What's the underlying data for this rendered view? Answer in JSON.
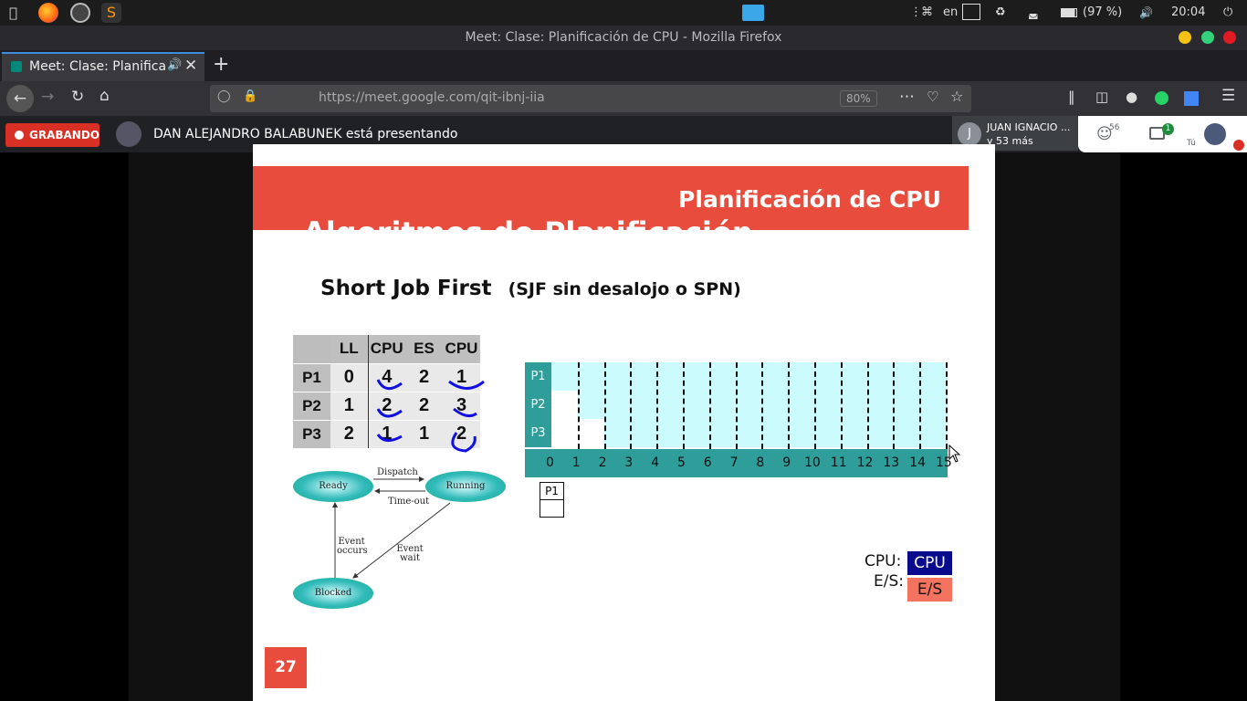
{
  "system": {
    "lang": "en",
    "battery": "(97 %)",
    "clock": "20:04"
  },
  "window": {
    "title": "Meet: Clase: Planificación de CPU - Mozilla Firefox"
  },
  "tab": {
    "label": "Meet: Clase: Planificac"
  },
  "nav": {
    "url": "https://meet.google.com/qit-ibnj-iia",
    "zoom": "80%"
  },
  "meet": {
    "recording_label": "GRABANDO",
    "presenter_text": "DAN ALEJANDRO BALABUNEK está presentando",
    "participant_name": "JUAN IGNACIO ...",
    "participant_more": "y 53 más",
    "participant_initial": "J",
    "people_count": "56",
    "chat_count": "1",
    "self_label": "Tú"
  },
  "slide": {
    "subtitle": "Planificación de CPU",
    "title": "Algoritmos de Planificación",
    "heading": "Short Job First",
    "heading_note": "(SJF sin desalojo o SPN)",
    "table": {
      "headers": [
        "LL",
        "CPU",
        "ES",
        "CPU"
      ],
      "rows": [
        {
          "name": "P1",
          "values": [
            "0",
            "4",
            "2",
            "1"
          ]
        },
        {
          "name": "P2",
          "values": [
            "1",
            "2",
            "2",
            "3"
          ]
        },
        {
          "name": "P3",
          "values": [
            "2",
            "1",
            "1",
            "2"
          ]
        }
      ]
    },
    "gantt": {
      "rows": [
        "P1",
        "P2",
        "P3"
      ],
      "ticks": [
        "0",
        "1",
        "2",
        "3",
        "4",
        "5",
        "6",
        "7",
        "8",
        "9",
        "10",
        "11",
        "12",
        "13",
        "14",
        "15"
      ]
    },
    "queue_label": "P1",
    "diagram": {
      "ready": "Ready",
      "running": "Running",
      "blocked": "Blocked",
      "dispatch": "Dispatch",
      "timeout": "Time-out",
      "event_occurs": "Event occurs",
      "event_wait": "Event wait"
    },
    "legend": {
      "cpu_label": "CPU:",
      "cpu_box": "CPU",
      "es_label": "E/S:",
      "es_box": "E/S"
    },
    "page_number": "27"
  }
}
